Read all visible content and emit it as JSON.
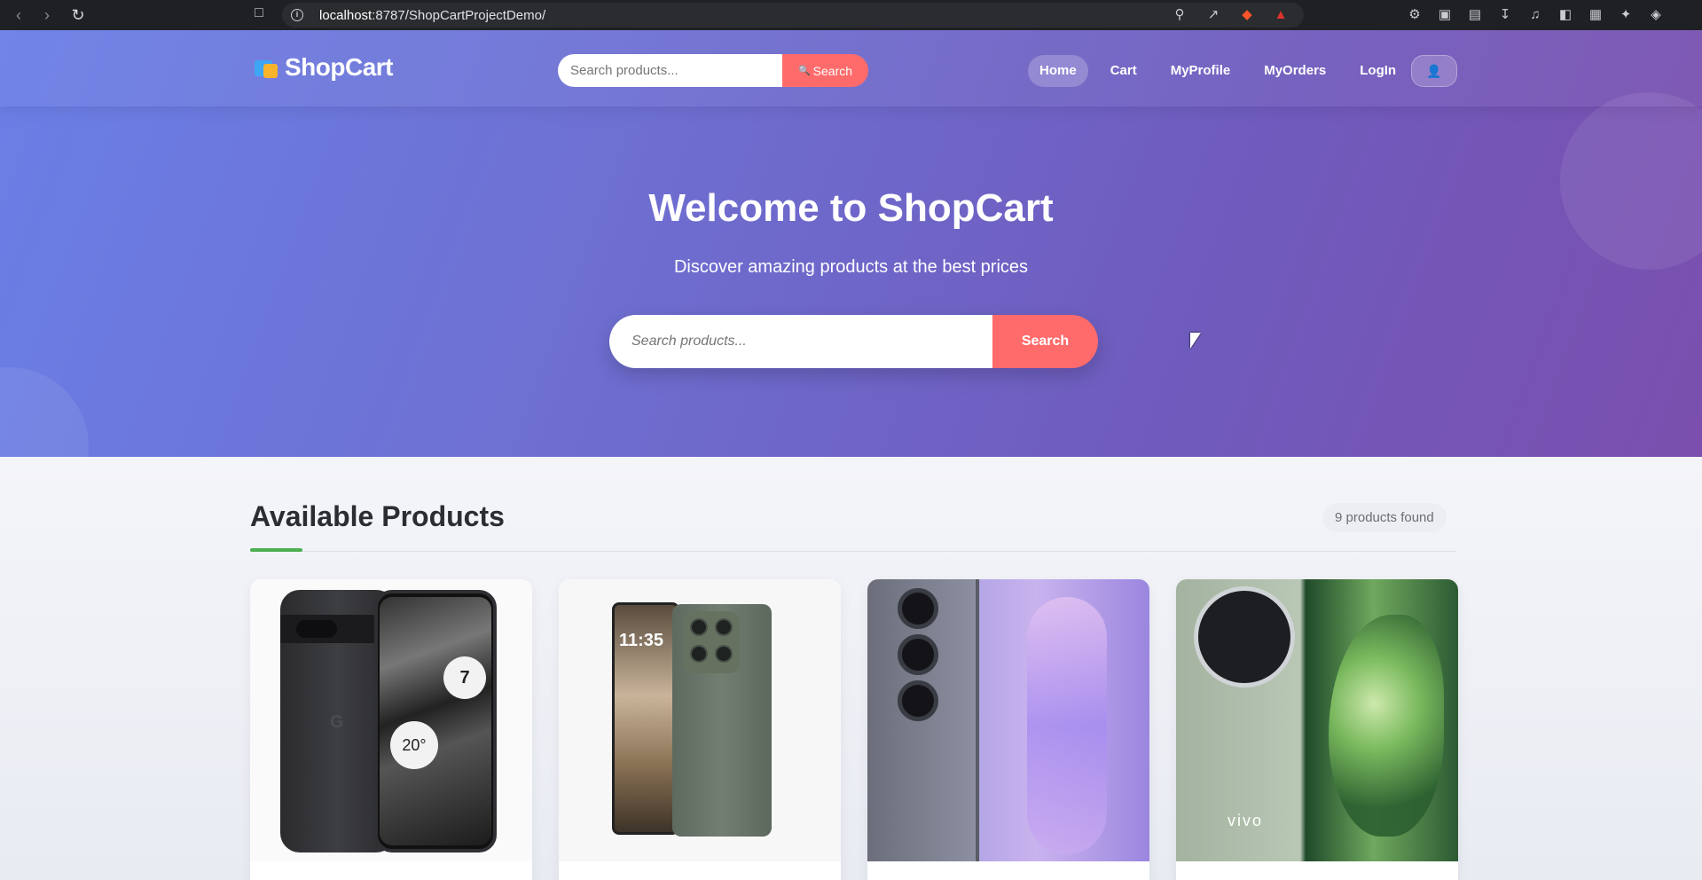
{
  "browser": {
    "url_host": "localhost",
    "url_rest": ":8787/ShopCartProjectDemo/"
  },
  "brand": {
    "name": "ShopCart"
  },
  "nav_search": {
    "placeholder": "Search products...",
    "button_label": "Search"
  },
  "nav": {
    "items": [
      {
        "label": "Home",
        "active": true
      },
      {
        "label": "Cart",
        "active": false
      },
      {
        "label": "MyProfile",
        "active": false
      },
      {
        "label": "MyOrders",
        "active": false
      },
      {
        "label": "LogIn",
        "active": false
      }
    ],
    "avatar_icon": "user-icon"
  },
  "hero": {
    "title": "Welcome to ShopCart",
    "subtitle": "Discover amazing products at the best prices",
    "search_placeholder": "Search products...",
    "search_button": "Search"
  },
  "products": {
    "heading": "Available Products",
    "count_label": "9 products found",
    "items": [
      {
        "image": "google-pixel-phone",
        "screen_clock": "7",
        "screen_temp": "20°"
      },
      {
        "image": "motorola-phone",
        "screen_time": "11:35"
      },
      {
        "image": "samsung-galaxy-ultra-phone"
      },
      {
        "image": "vivo-phone",
        "logo_text": "vivo"
      }
    ]
  },
  "colors": {
    "accent": "#ff6b6b",
    "hero_start": "#6a7fe6",
    "hero_end": "#7b4fae",
    "underline": "#4caf50"
  }
}
